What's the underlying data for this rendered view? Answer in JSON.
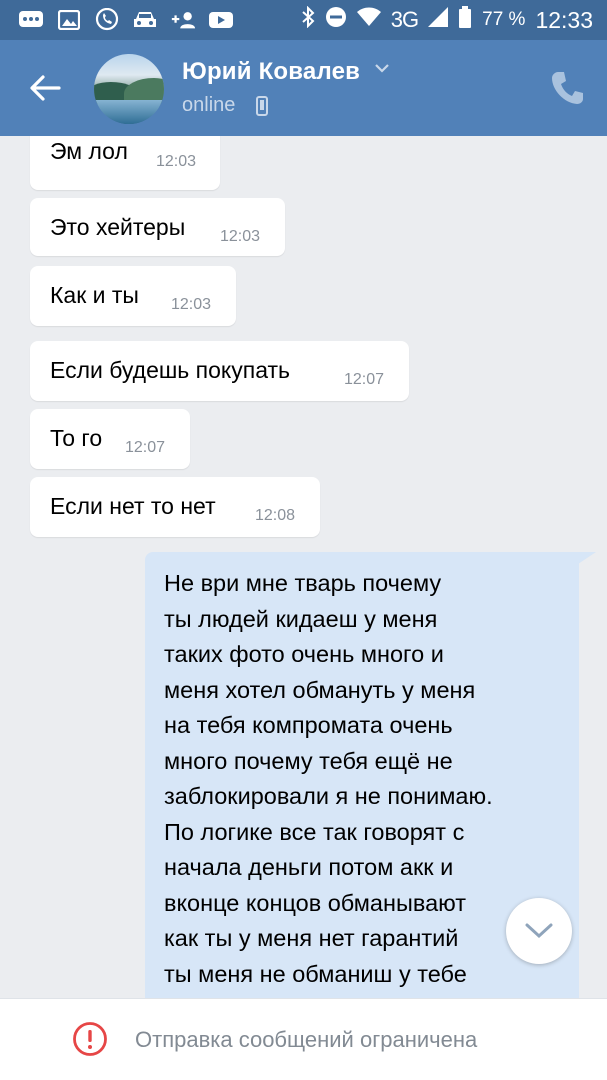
{
  "status_bar": {
    "network": "3G",
    "battery": "77 %",
    "time": "12:33",
    "icons": [
      "message-icon",
      "image-icon",
      "viber-icon",
      "car-icon",
      "add-contact-icon",
      "youtube-icon",
      "bluetooth-icon",
      "do-not-disturb-icon",
      "wifi-icon",
      "signal-icon",
      "battery-icon"
    ]
  },
  "header": {
    "contact_name": "Юрий Ковалев",
    "status": "online",
    "accent_color": "#5181b8"
  },
  "messages": {
    "incoming": [
      {
        "text": "Эм лол",
        "time": "12:03"
      },
      {
        "text": "Это хейтеры",
        "time": "12:03"
      },
      {
        "text": "Как и ты",
        "time": "12:03"
      },
      {
        "text": "Если будешь покупать",
        "time": "12:07"
      },
      {
        "text": "То го",
        "time": "12:07"
      },
      {
        "text": "Если нет то нет",
        "time": "12:08"
      }
    ],
    "outgoing": {
      "text": "Не ври мне тварь почему\nты людей кидаеш у меня\nтаких фото очень много и\nменя хотел обмануть у меня\nна тебя компромата очень\nмного почему  тебя ещё не\nзаблокировали я не понимаю.\nПо логике все так говорят с\nначала деньги потом акк и\nвконце концов обманывают\nкак ты у меня нет гарантий\nты меня не обманиш у тебе"
    }
  },
  "notice": {
    "text": "Отправка сообщений ограничена",
    "color": "#e64646"
  }
}
